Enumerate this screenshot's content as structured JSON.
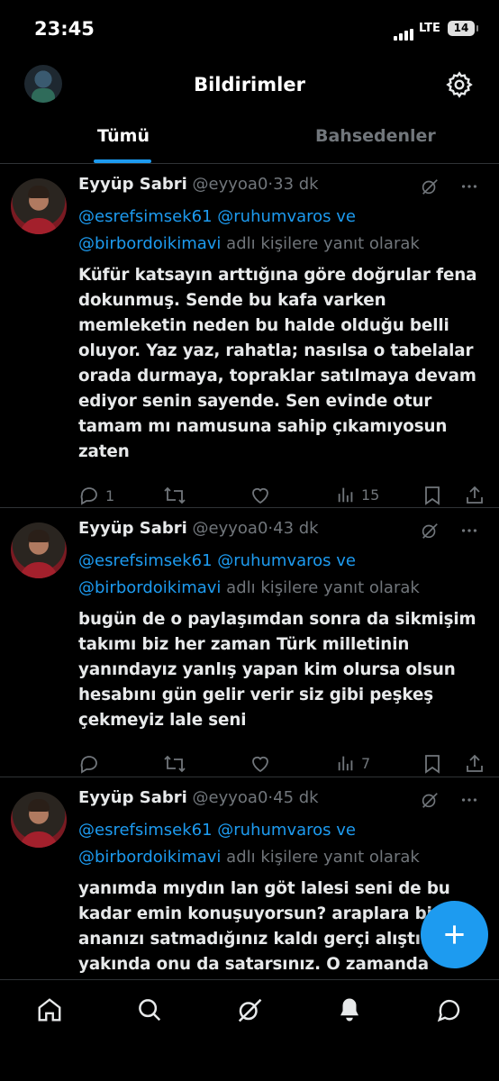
{
  "status": {
    "time": "23:45",
    "network": "LTE",
    "battery": "14"
  },
  "header": {
    "title": "Bildirimler"
  },
  "tabs": [
    {
      "label": "Tümü",
      "active": true
    },
    {
      "label": "Bahsedenler",
      "active": false
    }
  ],
  "tweets": [
    {
      "name": "Eyyüp Sabri",
      "handle": "@eyyoa0",
      "dot": "·",
      "time": "33 dk",
      "mentions": "@esrefsimsek61 @ruhumvaros ve",
      "mention2": "@birbordoikimavi",
      "reply_suffix": "adlı kişilere yanıt olarak",
      "text": "Küfür katsayın arttığına göre doğrular fena dokunmuş. Sende bu kafa varken memleketin neden bu halde olduğu belli oluyor. Yaz yaz, rahatla; nasılsa o tabelalar orada durmaya, topraklar satılmaya devam ediyor senin sayende. Sen evinde otur tamam mı namusuna sahip çıkamıyosun zaten",
      "replies": "1",
      "views": "15"
    },
    {
      "name": "Eyyüp Sabri",
      "handle": "@eyyoa0",
      "dot": "·",
      "time": "43 dk",
      "mentions": "@esrefsimsek61 @ruhumvaros ve",
      "mention2": "@birbordoikimavi",
      "reply_suffix": "adlı kişilere yanıt olarak",
      "text": "bugün de o paylaşımdan sonra da sikmişim takımı biz her zaman Türk milletinin yanındayız yanlış yapan kim olursa olsun hesabını gün gelir verir siz gibi peşkeş çekmeyiz lale seni",
      "replies": "",
      "views": "7"
    },
    {
      "name": "Eyyüp Sabri",
      "handle": "@eyyoa0",
      "dot": "·",
      "time": "45 dk",
      "mentions": "@esrefsimsek61 @ruhumvaros ve",
      "mention2": "@birbordoikimavi",
      "reply_suffix": "adlı kişilere yanıt olarak",
      "text": "yanımda mıydın lan göt lalesi seni de bu kadar emin konuşuyorsun? araplara bir ananızı satmadığınız kaldı gerçi alıştık yakında onu da satarsınız. O zamanda",
      "replies": "",
      "views": ""
    }
  ],
  "colors": {
    "accent": "#1d9bf0",
    "muted": "#71767b",
    "background": "#000000"
  },
  "icons": [
    "gear-icon",
    "reply-icon",
    "retweet-icon",
    "like-icon",
    "views-icon",
    "bookmark-icon",
    "share-icon",
    "grok-icon",
    "more-icon",
    "home-icon",
    "search-icon",
    "notifications-icon",
    "messages-icon",
    "plus-icon"
  ]
}
